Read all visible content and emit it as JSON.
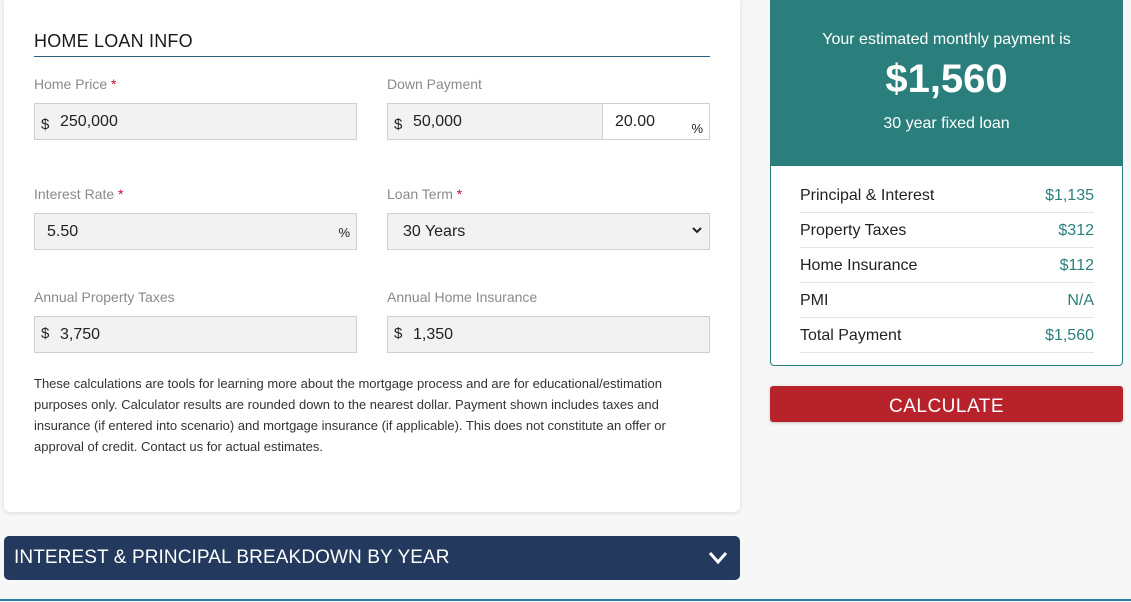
{
  "loan_info": {
    "title": "HOME LOAN INFO",
    "home_price": {
      "label": "Home Price",
      "required": "*",
      "prefix": "$",
      "value": "250,000"
    },
    "down_payment": {
      "label": "Down Payment",
      "prefix": "$",
      "value": "50,000",
      "percent_value": "20.00",
      "percent_suffix": "%"
    },
    "interest_rate": {
      "label": "Interest Rate",
      "required": "*",
      "value": "5.50",
      "suffix": "%"
    },
    "loan_term": {
      "label": "Loan Term",
      "required": "*",
      "selected": "30 Years"
    },
    "property_taxes": {
      "label": "Annual Property Taxes",
      "prefix": "$",
      "value": "3,750"
    },
    "home_insurance": {
      "label": "Annual Home Insurance",
      "prefix": "$",
      "value": "1,350"
    },
    "disclaimer": "These calculations are tools for learning more about the mortgage process and are for educational/estimation purposes only. Calculator results are rounded down to the nearest dollar. Payment shown includes taxes and insurance (if entered into scenario) and mortgage insurance (if applicable). This does not constitute an offer or approval of credit. Contact us for actual estimates."
  },
  "breakdown_accordion": {
    "title": "INTEREST & PRINCIPAL BREAKDOWN BY YEAR",
    "icon": "chevron-down-icon"
  },
  "summary": {
    "caption": "Your estimated monthly payment is",
    "amount": "$1,560",
    "term": "30 year fixed loan",
    "rows": [
      {
        "label": "Principal & Interest",
        "value": "$1,135"
      },
      {
        "label": "Property Taxes",
        "value": "$312"
      },
      {
        "label": "Home Insurance",
        "value": "$112"
      },
      {
        "label": "PMI",
        "value": "N/A"
      },
      {
        "label": "Total Payment",
        "value": "$1,560"
      }
    ]
  },
  "calculate_button": {
    "label": "CALCULATE"
  },
  "colors": {
    "teal": "#2a7f7c",
    "navy": "#233a5e",
    "red": "#b8232b",
    "required": "#c8102e"
  }
}
